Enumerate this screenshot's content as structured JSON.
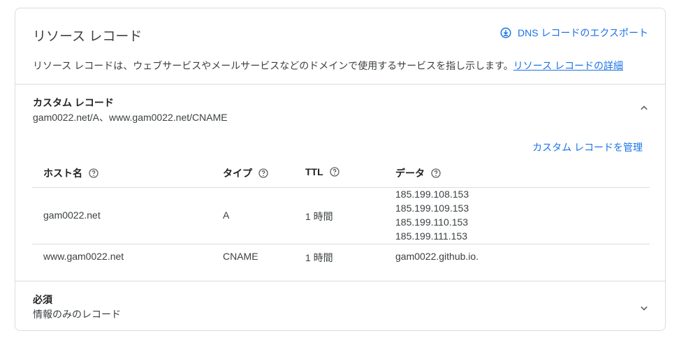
{
  "header": {
    "title": "リソース レコード",
    "export_label": "DNS レコードのエクスポート",
    "description": "リソース レコードは、ウェブサービスやメールサービスなどのドメインで使用するサービスを指し示します。",
    "description_link": "リソース レコードの詳細"
  },
  "custom_section": {
    "title": "カスタム レコード",
    "subtitle": "gam0022.net/A、www.gam0022.net/CNAME",
    "manage_label": "カスタム レコードを管理",
    "expanded": true,
    "columns": [
      "ホスト名",
      "タイプ",
      "TTL",
      "データ"
    ],
    "rows": [
      {
        "host": "gam0022.net",
        "type": "A",
        "ttl": "1 時間",
        "data": [
          "185.199.108.153",
          "185.199.109.153",
          "185.199.110.153",
          "185.199.111.153"
        ]
      },
      {
        "host": "www.gam0022.net",
        "type": "CNAME",
        "ttl": "1 時間",
        "data": [
          "gam0022.github.io."
        ]
      }
    ]
  },
  "required_section": {
    "title": "必須",
    "subtitle": "情報のみのレコード",
    "expanded": false
  },
  "icons": {
    "export": "download-circle-icon",
    "help": "help-circle-icon",
    "expand_less": "chevron-up-icon",
    "expand_more": "chevron-down-icon"
  },
  "colors": {
    "link": "#1a73e8",
    "divider": "#dadce0",
    "text": "#3c4043"
  }
}
